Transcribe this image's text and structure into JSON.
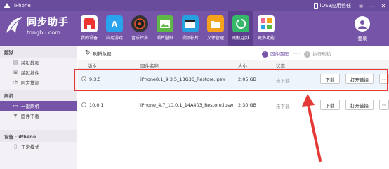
{
  "titlebar": {
    "title": "iPhone",
    "status_text": "iOS9应用信任",
    "controls": [
      "menu-icon",
      "minimize-icon",
      "close-icon"
    ]
  },
  "brand": {
    "name": "同步助手",
    "url": "tongbu.com"
  },
  "nav": [
    {
      "label": "我的设备",
      "icon": "store-icon",
      "color": "#ffffff"
    },
    {
      "label": "应用游戏",
      "icon": "appstore-icon",
      "color": "#2aa3ee"
    },
    {
      "label": "音乐铃声",
      "icon": "music-icon",
      "color": "#e9552a"
    },
    {
      "label": "照片壁纸",
      "icon": "photo-icon",
      "color": "#5fb846"
    },
    {
      "label": "视频影片",
      "icon": "video-icon",
      "color": "#27a0e0"
    },
    {
      "label": "文件管理",
      "icon": "folder-icon",
      "color": "#f3a21a"
    },
    {
      "label": "刷机越狱",
      "icon": "refresh-icon",
      "color": "#36b86a",
      "active": true
    },
    {
      "label": "更多功能",
      "icon": "grid-icon",
      "color": "#f06a8d"
    }
  ],
  "login_label": "登录",
  "sidebar": {
    "jailbreak_header": "越狱",
    "jailbreak_items": [
      "越狱教程",
      "越狱插件",
      "同步推源"
    ],
    "flash_header": "刷机",
    "flash_items": [
      "一键刷机",
      "固件下载"
    ],
    "device_header": "设备 - iPhone",
    "device_items": [
      "正常模式"
    ]
  },
  "toolbar": {
    "refresh_label": "刷新数据",
    "step1_num": "1",
    "step1_label": "固件匹配",
    "step2_num": "2",
    "step2_label": "执行刷机"
  },
  "table": {
    "headers": [
      "版本",
      "固件名称",
      "大小",
      "状态"
    ],
    "rows": [
      {
        "version": "9.3.5",
        "name": "iPhone8,1_9.3.5_13G36_Restore.ipsw",
        "size": "2.05 GB",
        "status": "未下载",
        "download": "下载",
        "open_link": "打开链接",
        "selected": true
      },
      {
        "version": "10.0.1",
        "name": "iPhone_4.7_10.0.1_14A403_Restore.ipsw",
        "size": "2.30 GB",
        "status": "未下载",
        "download": "下载",
        "open_link": "打开链接",
        "selected": false
      }
    ]
  },
  "colors": {
    "brand": "#7654a8",
    "highlight": "#e53935"
  }
}
